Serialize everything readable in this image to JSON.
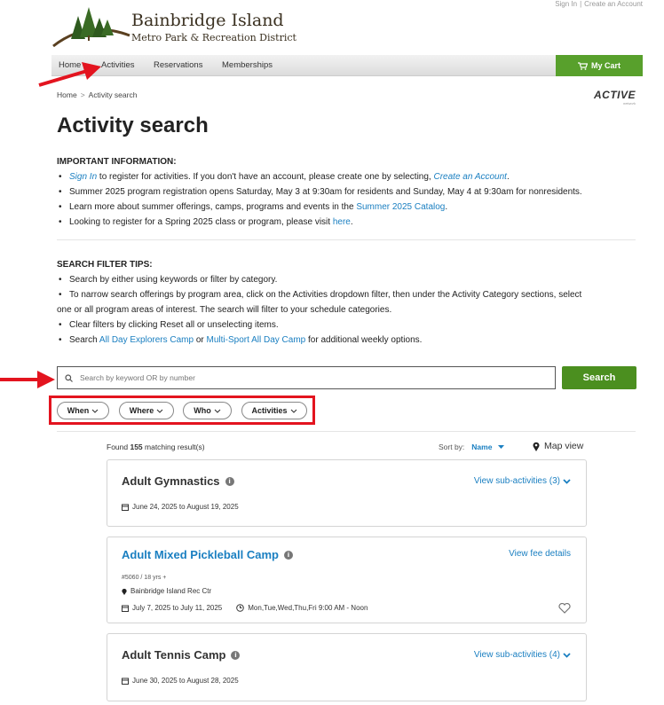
{
  "header": {
    "sign_in": "Sign In",
    "separator": "|",
    "create_account": "Create an Account",
    "logo_title": "Bainbridge Island",
    "logo_subtitle": "Metro Park & Recreation District"
  },
  "nav": {
    "items": [
      "Home",
      "Activities",
      "Reservations",
      "Memberships"
    ],
    "cart_label": "My Cart"
  },
  "breadcrumb": {
    "home": "Home",
    "separator": ">",
    "current": "Activity search"
  },
  "active_logo": {
    "brand": "ACTIVE",
    "tag": "network"
  },
  "page_title": "Activity search",
  "important": {
    "heading": "IMPORTANT INFORMATION:",
    "b1_link": "Sign In",
    "b1_text": " to register for activities. If you don't have an account, please create one by selecting, ",
    "b1_link2": "Create an Account",
    "b1_end": ".",
    "b2": "Summer 2025 program registration opens Saturday, May 3 at 9:30am for residents and Sunday, May 4 at 9:30am for nonresidents.",
    "b3_text": "Learn more about summer offerings, camps, programs and events in the ",
    "b3_link": "Summer 2025 Catalog",
    "b3_end": ".",
    "b4_text": "Looking to register for a Spring 2025 class or program, please visit ",
    "b4_link": "here",
    "b4_end": "."
  },
  "tips": {
    "heading": "SEARCH FILTER TIPS:",
    "t1": "Search by either using keywords or filter by category.",
    "t2a": "To narrow search offerings by program area, click on the Activities dropdown filter, then under the Activity Category sections, select",
    "t2b": "one or all program areas of interest. The search will filter to your schedule categories.",
    "t3": "Clear filters by clicking Reset all or unselecting items.",
    "t4_text": "Search ",
    "t4_link1": "All Day Explorers Camp",
    "t4_mid": " or ",
    "t4_link2": "Multi-Sport All Day Camp",
    "t4_end": " for additional weekly options."
  },
  "search": {
    "placeholder": "Search by keyword OR by number",
    "button": "Search"
  },
  "filters": [
    "When",
    "Where",
    "Who",
    "Activities"
  ],
  "results": {
    "found_prefix": "Found ",
    "count": "155",
    "found_suffix": " matching result(s)",
    "sort_label": "Sort by:",
    "sort_value": "Name",
    "map_view": "Map view"
  },
  "cards": [
    {
      "title": "Adult Gymnastics",
      "link": "View sub-activities (3)",
      "dates": "June 24, 2025 to August 19, 2025"
    },
    {
      "title": "Adult Mixed Pickleball Camp",
      "link": "View fee details",
      "number": "#5060 / 18 yrs +",
      "location": "Bainbridge Island Rec Ctr",
      "dates": "July 7, 2025 to July 11, 2025",
      "schedule": "Mon,Tue,Wed,Thu,Fri 9:00 AM - Noon"
    },
    {
      "title": "Adult Tennis Camp",
      "link": "View sub-activities (4)",
      "dates": "June 30, 2025 to August 28, 2025"
    }
  ],
  "colors": {
    "accent_green": "#58a02c",
    "search_green": "#4b8f1f",
    "link_blue": "#1a7fc1",
    "annotation_red": "#e3141f"
  }
}
